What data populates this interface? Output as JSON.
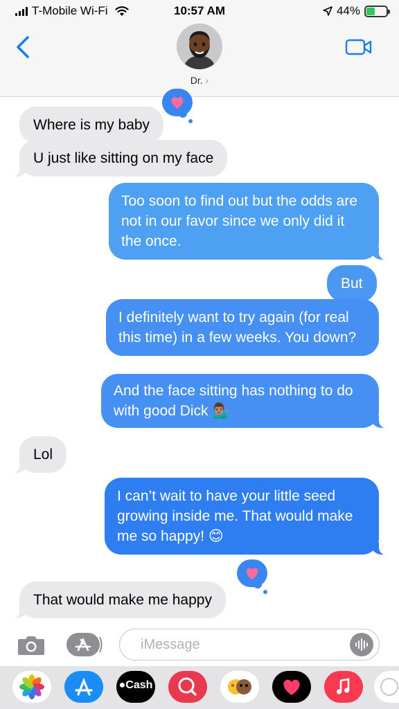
{
  "status_bar": {
    "carrier": "T-Mobile Wi-Fi",
    "time": "10:57 AM",
    "battery": "44%",
    "battery_level": 0.44
  },
  "header": {
    "contact_name": "Dr.",
    "chevron": "›",
    "icons": [
      "back-chevron-icon",
      "memoji-avatar",
      "video-call-icon"
    ]
  },
  "messages": [
    {
      "direction": "incoming",
      "text": "Where is my baby",
      "tapback": "heart"
    },
    {
      "direction": "incoming",
      "text": "U just like sitting on my face"
    },
    {
      "direction": "outgoing",
      "text": "Too soon to find out but the odds are not in our favor since we only did it the once."
    },
    {
      "direction": "outgoing",
      "text": "But"
    },
    {
      "direction": "outgoing",
      "text": "I definitely want to try again (for real this time) in a few weeks. You down?"
    },
    {
      "direction": "outgoing",
      "text": "And the face sitting has nothing to do with good Dick 💁🏽‍♂️"
    },
    {
      "direction": "incoming",
      "text": "Lol"
    },
    {
      "direction": "outgoing",
      "text": "I can’t wait to have your little seed growing inside me. That would make me so happy! 😊"
    },
    {
      "direction": "incoming",
      "text": "That would make me happy",
      "tapback": "heart"
    }
  ],
  "input": {
    "placeholder": "iMessage"
  },
  "drawer": {
    "cash_label": "Cash",
    "apps": [
      "photos-icon",
      "app-store-icon",
      "apple-cash-icon",
      "search-images-icon",
      "memoji-stickers-icon",
      "digital-touch-icon",
      "music-icon",
      "more-icon"
    ]
  },
  "colors": {
    "incoming_bubble": "#e9e9eb",
    "outgoing_bubble": "#3c86f1",
    "accent": "#1a7cf5"
  }
}
